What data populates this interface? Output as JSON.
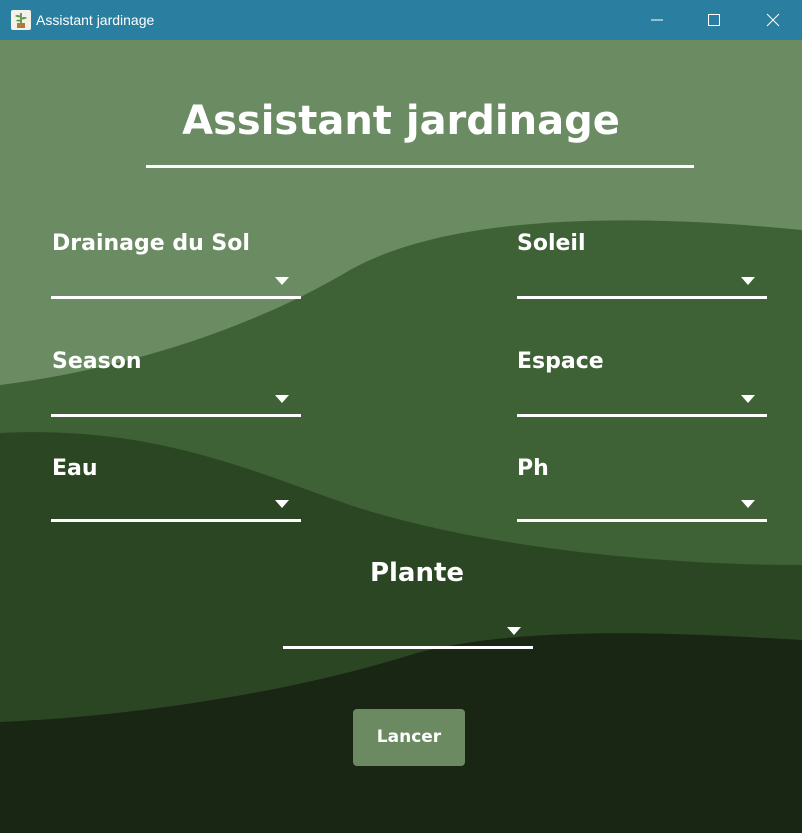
{
  "window": {
    "title": "Assistant jardinage",
    "titlebar_color": "#2a7fa0",
    "controls": [
      "minimize-icon",
      "maximize-icon",
      "close-icon"
    ]
  },
  "form": {
    "heading": "Assistant jardinage",
    "fields": {
      "drainage": {
        "label": "Drainage du Sol",
        "value": ""
      },
      "soleil": {
        "label": "Soleil",
        "value": ""
      },
      "season": {
        "label": "Season",
        "value": ""
      },
      "espace": {
        "label": "Espace",
        "value": ""
      },
      "eau": {
        "label": "Eau",
        "value": ""
      },
      "ph": {
        "label": "Ph",
        "value": ""
      },
      "plante": {
        "label": "Plante",
        "value": ""
      }
    },
    "launch_label": "Lancer"
  },
  "colors": {
    "light_green": "#6b8c63",
    "mid_green": "#3e6235",
    "dark_green": "#2b4623",
    "darkest_green": "#1a2614",
    "button": "#6b8a62"
  }
}
